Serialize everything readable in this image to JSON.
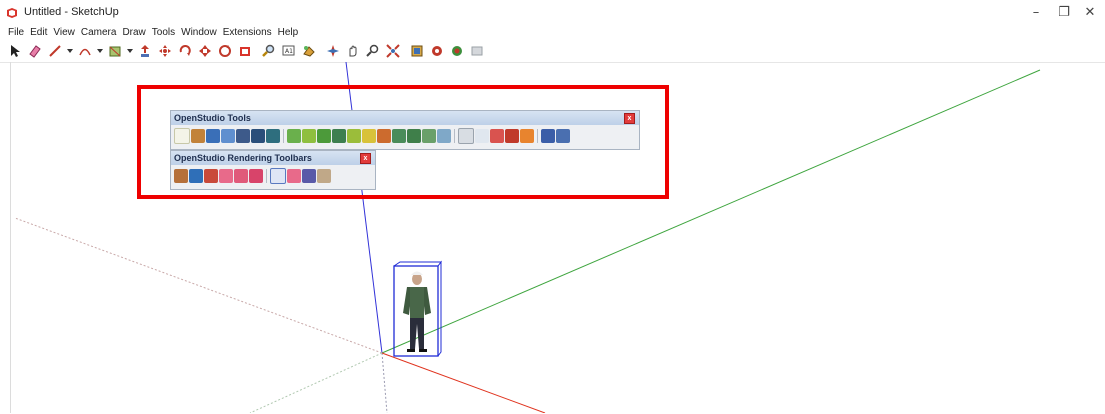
{
  "window": {
    "title": "Untitled - SketchUp",
    "minimize_glyph": "–",
    "maximize_glyph": "❐",
    "close_glyph": "✕"
  },
  "menu": {
    "items": [
      "File",
      "Edit",
      "View",
      "Camera",
      "Draw",
      "Tools",
      "Window",
      "Extensions",
      "Help"
    ]
  },
  "toolbar": {
    "icons": [
      "select-icon",
      "eraser-icon",
      "line-icon",
      "arc-icon",
      "shape-icon",
      "pushpull-icon",
      "move-icon",
      "rotate-icon",
      "scale-icon",
      "offset-icon",
      "tape-icon",
      "text-icon",
      "paint-icon",
      "orbit-icon",
      "pan-icon",
      "zoom-icon",
      "zoom-extents-icon",
      "warehouse-icon",
      "extension-warehouse-icon",
      "ruby-icon",
      "layout-icon"
    ]
  },
  "panels": {
    "openstudio_tools": {
      "title": "OpenStudio Tools",
      "close_glyph": "x"
    },
    "openstudio_rendering": {
      "title": "OpenStudio Rendering Toolbars",
      "close_glyph": "x"
    }
  },
  "colors": {
    "axis_red": "#e0341f",
    "axis_green": "#3fa53f",
    "axis_blue": "#3232d8",
    "highlight": "#ee0000"
  }
}
